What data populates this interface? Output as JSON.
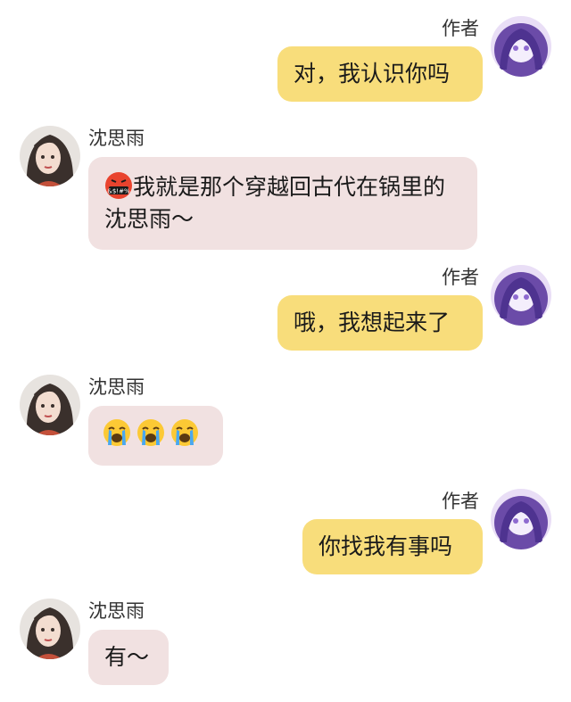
{
  "messages": [
    {
      "side": "right",
      "name": "作者",
      "text": "对，我认识你吗"
    },
    {
      "side": "left",
      "name": "沈思雨",
      "emoji_prefix": "cursing-face-emoji",
      "text": "我就是那个穿越回古代在锅里的沈思雨～"
    },
    {
      "side": "right",
      "name": "作者",
      "text": "哦，我想起来了"
    },
    {
      "side": "left",
      "name": "沈思雨",
      "emojis": [
        "loudly-crying-face-emoji",
        "loudly-crying-face-emoji",
        "loudly-crying-face-emoji"
      ]
    },
    {
      "side": "right",
      "name": "作者",
      "text": "你找我有事吗"
    },
    {
      "side": "left",
      "name": "沈思雨",
      "text": "有～"
    }
  ],
  "colors": {
    "right_bubble": "#f8dd7b",
    "left_bubble": "#f1e1e1",
    "name_text": "#333333",
    "author_avatar_purple": "#7a5bb8"
  }
}
